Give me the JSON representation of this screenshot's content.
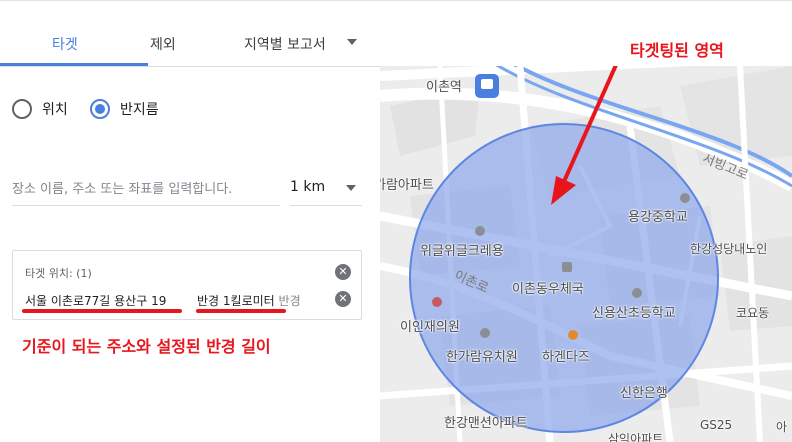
{
  "tabs": {
    "target_label": "타겟",
    "exclude_label": "제외",
    "region_report_label": "지역별 보고서"
  },
  "radio": {
    "location_label": "위치",
    "radius_label": "반지름",
    "selected": "반지름"
  },
  "search": {
    "placeholder": "장소 이름, 주소 또는 좌표를 입력합니다.",
    "value": ""
  },
  "distance": {
    "value": "1 km"
  },
  "target_panel": {
    "title": "타겟 위치: (1)",
    "address": "서울 이촌로77길 용산구 19",
    "radius_value": "반경 1킬로미터",
    "radius_suffix": "반경"
  },
  "annotations": {
    "panel_caption": "기준이 되는 주소와 설정된 반경 길이",
    "map_caption": "타겟팅된 영역",
    "accent_color": "#e8161c"
  },
  "map": {
    "circle_fill": "#8fa9ec",
    "labels": {
      "ichon_station": "이촌역",
      "garam_apt": "가람아파트",
      "wigeul": "위글위글크레용",
      "yonggang_ms": "용강중학교",
      "hangang_church": "한강성당내노인",
      "ichon_ro": "이촌로",
      "ichon_post": "이촌동우체국",
      "sinyongsan_es": "신용산초등학교",
      "koyo": "코요동",
      "ijaejae": "이인재의원",
      "hangaram_kinder": "한가람유치원",
      "haagen": "하겐다즈",
      "shinhan": "신한은행",
      "hangang_mansion": "한강맨션아파트",
      "gs25": "GS25",
      "seobinggo": "서빙고로",
      "samik_apt": "삼익아파트",
      "a_short": "아"
    },
    "icons": [
      "subway-icon",
      "school-icon",
      "post-office-icon",
      "clinic-icon",
      "restaurant-icon"
    ]
  }
}
